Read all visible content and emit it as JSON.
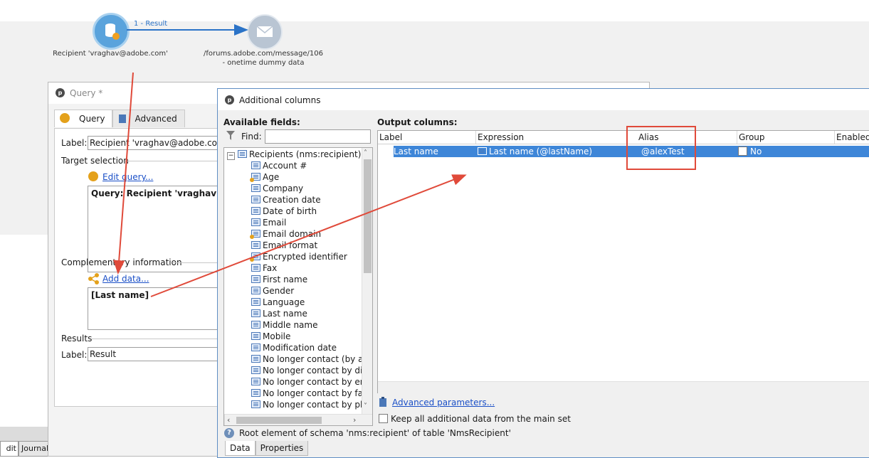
{
  "workflow": {
    "node1_label": "Recipient 'vraghav@adobe.com'",
    "link_label": "1 - Result",
    "node2_label_line1": "/forums.adobe.com/message/106",
    "node2_label_line2": "- onetime dummy data"
  },
  "query_window": {
    "title": "Query *",
    "tabs": [
      "Query",
      "Advanced"
    ],
    "label_caption": "Label:",
    "label_value": "Recipient 'vraghav@adobe.com'",
    "target_selection": "Target selection",
    "edit_query_link": "Edit query...",
    "query_text": "Query: Recipient 'vraghav@adob",
    "complementary_information": "Complementary information",
    "add_data_link": "Add data...",
    "added_data": "[Last name]",
    "results": "Results",
    "results_label_caption": "Label:",
    "results_label_value": "Result"
  },
  "status_bar": {
    "tabs": [
      "dit",
      "Journal"
    ]
  },
  "dialog": {
    "title": "Additional columns",
    "available_fields": "Available fields:",
    "find_label": "Find:",
    "find_value": "",
    "tree_root": "Recipients (nms:recipient)",
    "fields": [
      {
        "label": "Account #",
        "calc": false
      },
      {
        "label": "Age",
        "calc": true
      },
      {
        "label": "Company",
        "calc": false
      },
      {
        "label": "Creation date",
        "calc": false
      },
      {
        "label": "Date of birth",
        "calc": false
      },
      {
        "label": "Email",
        "calc": false
      },
      {
        "label": "Email domain",
        "calc": true
      },
      {
        "label": "Email format",
        "calc": false
      },
      {
        "label": "Encrypted identifier",
        "calc": true
      },
      {
        "label": "Fax",
        "calc": false
      },
      {
        "label": "First name",
        "calc": false
      },
      {
        "label": "Gender",
        "calc": false
      },
      {
        "label": "Language",
        "calc": false
      },
      {
        "label": "Last name",
        "calc": false
      },
      {
        "label": "Middle name",
        "calc": false
      },
      {
        "label": "Mobile",
        "calc": false
      },
      {
        "label": "Modification date",
        "calc": false
      },
      {
        "label": "No longer contact (by any",
        "calc": false
      },
      {
        "label": "No longer contact by direc",
        "calc": false
      },
      {
        "label": "No longer contact by ema",
        "calc": false
      },
      {
        "label": "No longer contact by fax",
        "calc": false
      },
      {
        "label": "No longer contact by pho",
        "calc": false
      }
    ],
    "output_columns": "Output columns:",
    "columns": [
      "Label",
      "Expression",
      "Alias",
      "Group",
      "Enabled i"
    ],
    "row": {
      "label": "Last name",
      "expression": "Last name (@lastName)",
      "alias": "@alexTest",
      "group": "No"
    },
    "advanced_parameters_link": "Advanced parameters...",
    "keep_all_label": "Keep all additional data from the main set",
    "help_text": "Root element of schema 'nms:recipient' of table 'NmsRecipient'",
    "bottom_tabs": [
      "Data",
      "Properties"
    ]
  },
  "colors": {
    "selection": "#3e86d8",
    "annotation": "#e04a3a",
    "link": "#1a4fc7"
  }
}
